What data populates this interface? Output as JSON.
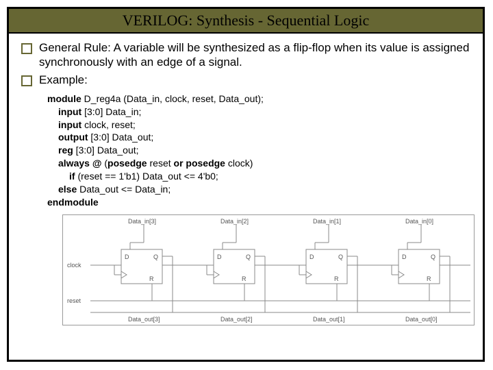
{
  "title": "VERILOG: Synthesis - Sequential Logic",
  "bullets": {
    "b1": "General Rule: A variable will be synthesized as a flip-flop when its value is assigned synchronously with an edge of a signal.",
    "b2": "Example:"
  },
  "code": {
    "l1a": "module",
    "l1b": " D_reg4a (Data_in, clock, reset, Data_out);",
    "l2a": "input",
    "l2b": " [3:0] Data_in;",
    "l3a": "input",
    "l3b": " clock, reset;",
    "l4a": "output",
    "l4b": " [3:0] Data_out;",
    "l5a": "reg",
    "l5b": " [3:0] Data_out;",
    "l6a": "always @",
    "l6b": " (",
    "l6c": "posedge",
    "l6d": " reset ",
    "l6e": "or",
    "l6f": " ",
    "l6g": "posedge",
    "l6h": " clock)",
    "l7a": "if",
    "l7b": " (reset == 1'b1) Data_out <= 4'b0;",
    "l8a": "else",
    "l8b": " Data_out <= Data_in;",
    "l9": "endmodule"
  },
  "diagram": {
    "top": {
      "d3": "Data_in[3]",
      "d2": "Data_in[2]",
      "d1": "Data_in[1]",
      "d0": "Data_in[0]"
    },
    "bot": {
      "d3": "Data_out[3]",
      "d2": "Data_out[2]",
      "d1": "Data_out[1]",
      "d0": "Data_out[0]"
    },
    "side": {
      "clock": "clock",
      "reset": "reset"
    },
    "ff": {
      "D": "D",
      "Q": "Q",
      "R": "R"
    }
  }
}
